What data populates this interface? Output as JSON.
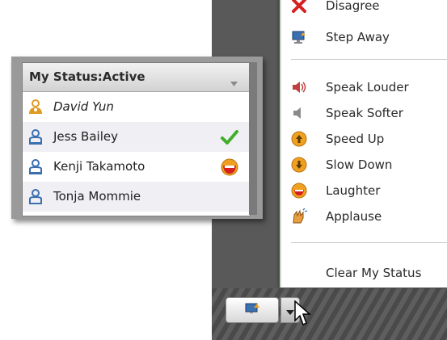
{
  "menu": {
    "items": [
      {
        "label": "Disagree",
        "icon": "red-x-icon"
      },
      {
        "label": "Step Away",
        "icon": "step-away-icon"
      },
      {
        "label": "Speak Louder",
        "icon": "speaker-loud-icon"
      },
      {
        "label": "Speak Softer",
        "icon": "speaker-soft-icon"
      },
      {
        "label": "Speed Up",
        "icon": "speed-up-icon"
      },
      {
        "label": "Slow Down",
        "icon": "slow-down-icon"
      },
      {
        "label": "Laughter",
        "icon": "laughter-icon"
      },
      {
        "label": "Applause",
        "icon": "applause-icon"
      }
    ],
    "clear_label": "Clear My Status"
  },
  "panel": {
    "title": "My Status:Active",
    "users": [
      {
        "name": "David Yun",
        "italic": true,
        "status_icon": "",
        "role": "host"
      },
      {
        "name": "Jess Bailey",
        "italic": false,
        "status_icon": "checkmark-icon",
        "role": "participant"
      },
      {
        "name": "Kenji Takamoto",
        "italic": false,
        "status_icon": "laughter-icon",
        "role": "participant"
      },
      {
        "name": "Tonja Mommie",
        "italic": false,
        "status_icon": "",
        "role": "participant"
      }
    ]
  },
  "colors": {
    "check": "#3fae2a",
    "red_x": "#d42020",
    "orange": "#f0a020",
    "user_blue": "#3a6fb0",
    "host_orange": "#e09a20"
  }
}
